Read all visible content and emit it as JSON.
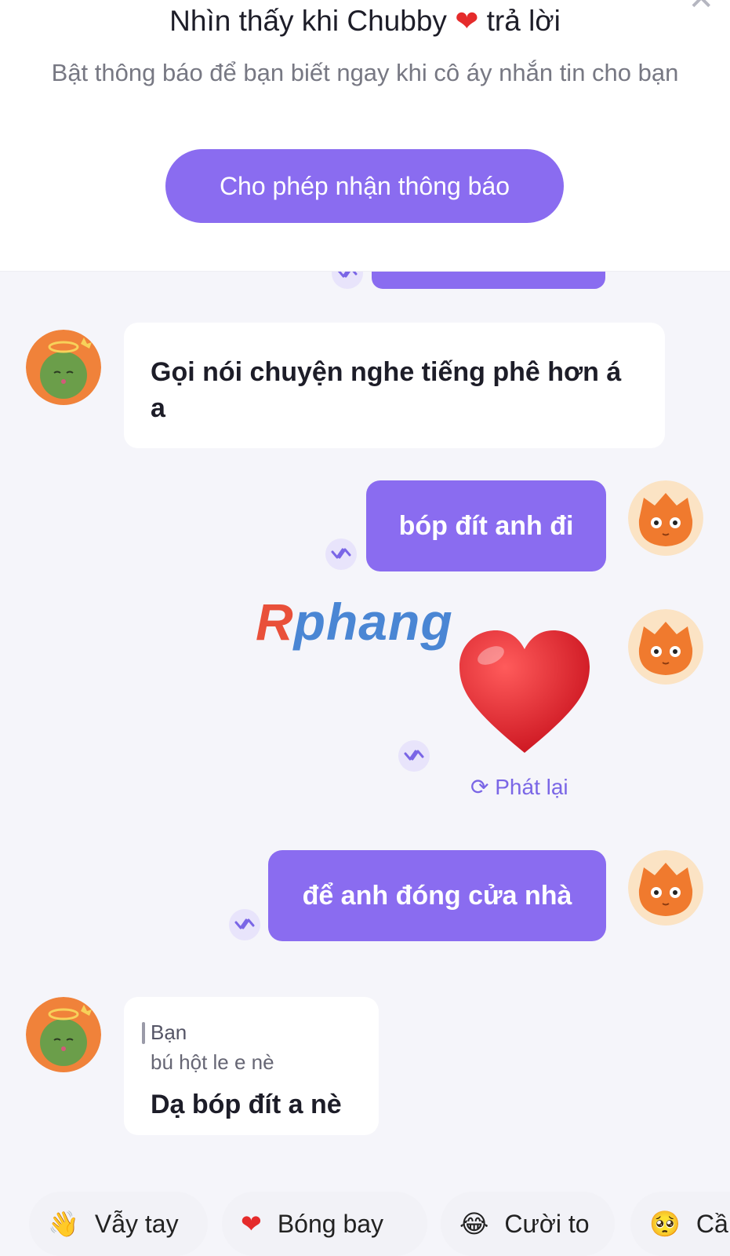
{
  "banner": {
    "title_before": "Nhìn thấy khi Chubby",
    "title_heart": "❤",
    "title_after": "trả lời",
    "subtitle": "Bật thông báo để bạn biết ngay khi cô áy nhắn tin cho bạn",
    "allow_button": "Cho phép nhận thông báo"
  },
  "messages": {
    "m1_in": "Gọi nói chuyện nghe tiếng phê hơn á a",
    "m2_out": "bóp đít anh đi",
    "m3_sticker": "❤",
    "m3_replay": "Phát lại",
    "m4_out": "để anh đóng cửa nhà",
    "m5_quote_author": "Bạn",
    "m5_quote_text": "bú hột le e nè",
    "m5_in": "Dạ bóp đít a nè"
  },
  "watermark": {
    "r": "R",
    "rest": "phang"
  },
  "quick_replies": [
    {
      "emoji": "👋",
      "label": "Vẫy tay"
    },
    {
      "emoji": "❤",
      "label": "Bóng bay"
    },
    {
      "emoji": "😂",
      "label": "Cười to"
    },
    {
      "emoji": "🥺",
      "label": "Cầ"
    }
  ],
  "colors": {
    "accent": "#8a6cf0",
    "chat_bg": "#f5f5fa",
    "heart": "#e52b2b"
  }
}
